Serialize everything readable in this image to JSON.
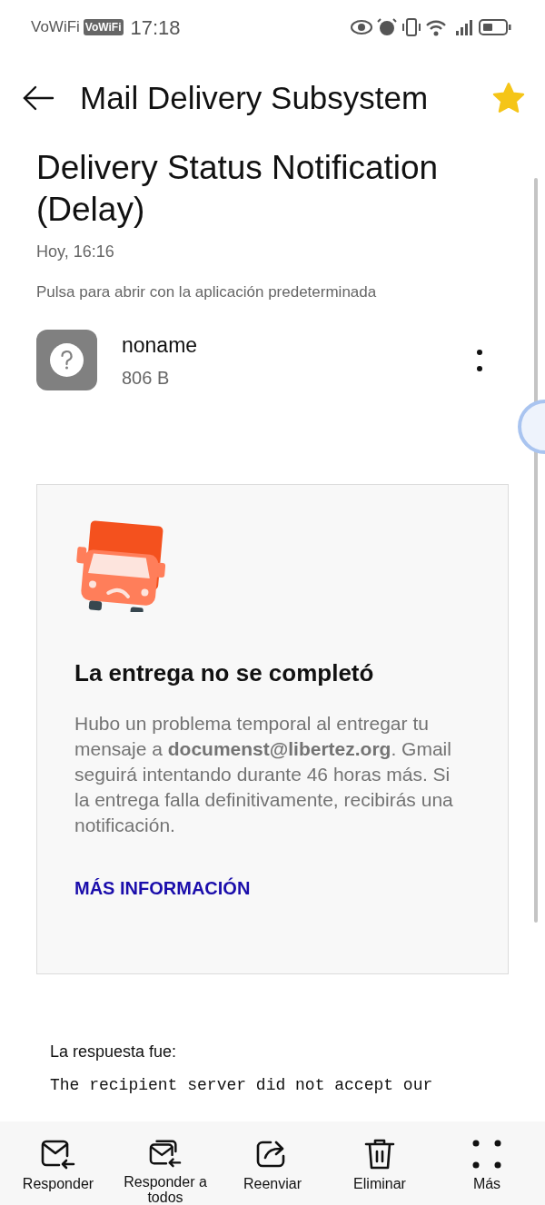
{
  "status_bar": {
    "carrier": "VoWiFi",
    "badge": "VoWiFi",
    "time": "17:18"
  },
  "header": {
    "title": "Mail Delivery Subsystem",
    "starred": true
  },
  "message": {
    "subject": "Delivery Status Notification (Delay)",
    "date": "Hoy, 16:16",
    "open_hint": "Pulsa para abrir con la aplicación predeterminada"
  },
  "attachment": {
    "name": "noname",
    "size": "806 B"
  },
  "notice": {
    "heading": "La entrega no se completó",
    "body": "Hubo un problema temporal al entregar tu mensaje a **documenst@libertez.org**. Gmail seguirá intentando durante 46 horas más. Si la entrega falla definitivamente, recibirás una notificación.",
    "link": "MÁS INFORMACIÓN"
  },
  "reply_label": "La respuesta fue:",
  "reply_text": "The recipient server did not accept our",
  "toolbar": [
    {
      "kind": "reply",
      "label": "Responder"
    },
    {
      "kind": "reply_all",
      "label": "Responder a todos"
    },
    {
      "kind": "forward",
      "label": "Reenviar"
    },
    {
      "kind": "delete",
      "label": "Eliminar"
    },
    {
      "kind": "more",
      "label": "Más"
    }
  ]
}
